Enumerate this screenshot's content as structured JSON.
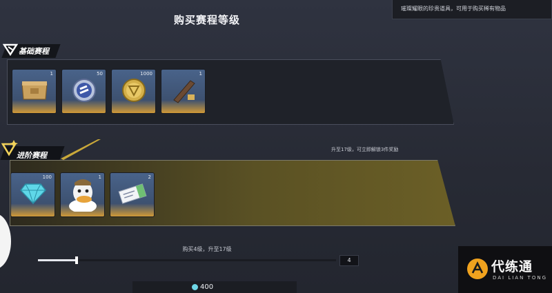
{
  "header": {
    "title": "购买赛程等级"
  },
  "tooltip": {
    "text": "璀璨耀眼的珍贵道具，可用于购买稀有物品"
  },
  "basic": {
    "label": "基础赛程",
    "items": [
      {
        "icon": "crate-icon",
        "qty": "1"
      },
      {
        "icon": "blue-coin-icon",
        "qty": "50"
      },
      {
        "icon": "gold-coin-icon",
        "qty": "1000"
      },
      {
        "icon": "wooden-plank-icon",
        "qty": "1"
      }
    ]
  },
  "advanced": {
    "label": "进阶赛程",
    "hint": "升至17级，可立即解锁3件奖励",
    "items": [
      {
        "icon": "diamond-icon",
        "qty": "100"
      },
      {
        "icon": "duck-avatar-icon",
        "qty": "1"
      },
      {
        "icon": "ticket-card-icon",
        "qty": "2"
      }
    ]
  },
  "purchase": {
    "text": "购买4级，升至17级",
    "quantity": "4",
    "progress": 0.13,
    "price": "400"
  },
  "watermark": {
    "cn": "代练通",
    "en": "DAI LIAN TONG"
  },
  "colors": {
    "accent_gold": "#c7842a",
    "panel_gold": "#6b5f26",
    "bg": "#2b2f3a"
  }
}
